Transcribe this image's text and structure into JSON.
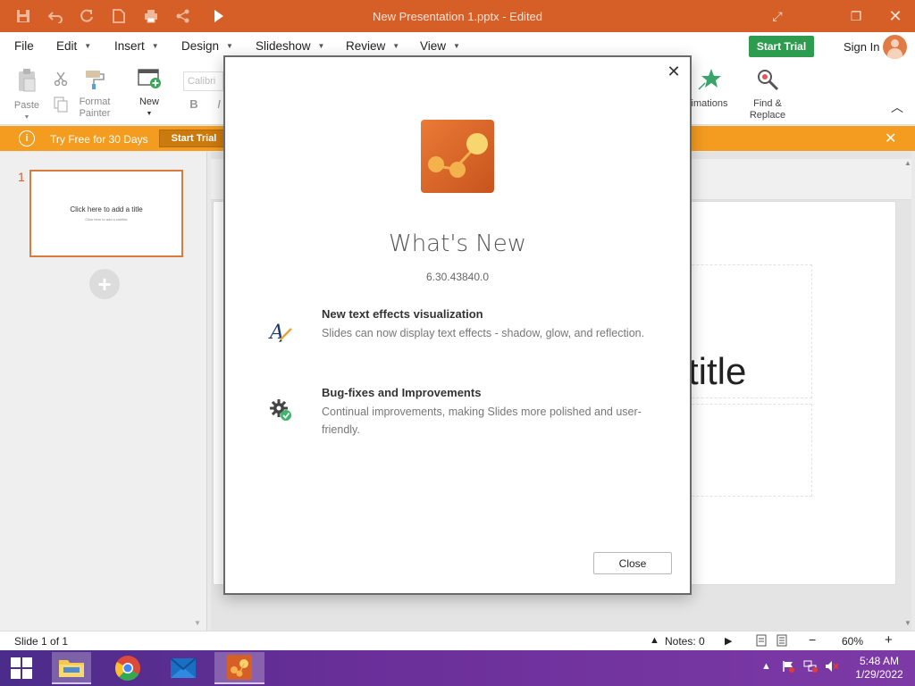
{
  "window": {
    "title": "New Presentation 1.pptx - Edited",
    "quick_access": [
      "save-icon",
      "undo-icon",
      "redo-icon",
      "new-document-icon",
      "print-icon",
      "share-icon",
      "customize-icon"
    ]
  },
  "menu": {
    "items": [
      "File",
      "Edit",
      "Insert",
      "Design",
      "Slideshow",
      "Review",
      "View"
    ],
    "start_trial": "Start Trial",
    "sign_in": "Sign In"
  },
  "ribbon": {
    "paste": "Paste",
    "format_painter_1": "Format",
    "format_painter_2": "Painter",
    "new": "New",
    "font_placeholder": "Calibri",
    "bold": "B",
    "italic": "I",
    "animations": "imations",
    "find_replace_1": "Find &",
    "find_replace_2": "Replace"
  },
  "banner": {
    "icon": "i",
    "text": "Try Free for 30 Days",
    "button": "Start Trial"
  },
  "slides_panel": {
    "slide_number": "1",
    "thumb_title": "Click here to add a title",
    "thumb_subtitle": "Click here to add a subtitle"
  },
  "canvas": {
    "title_fragment": "title"
  },
  "status": {
    "slide_info": "Slide 1 of 1",
    "notes": "Notes: 0",
    "zoom": "60%",
    "zoom_minus": "−",
    "zoom_plus": "+"
  },
  "taskbar": {
    "time": "5:48 AM",
    "date": "1/29/2022"
  },
  "dialog": {
    "heading": "What's New",
    "version": "6.30.43840.0",
    "features": [
      {
        "title": "New text effects visualization",
        "description": "Slides can now display text effects - shadow, glow, and reflection."
      },
      {
        "title": "Bug-fixes and Improvements",
        "description": "Continual improvements, making Slides more polished and user-friendly."
      }
    ],
    "close_button": "Close"
  },
  "colors": {
    "titlebar": "#d65f27",
    "banner": "#f39c1f",
    "trial_button": "#2e9c4f",
    "accent": "#d65f27"
  }
}
